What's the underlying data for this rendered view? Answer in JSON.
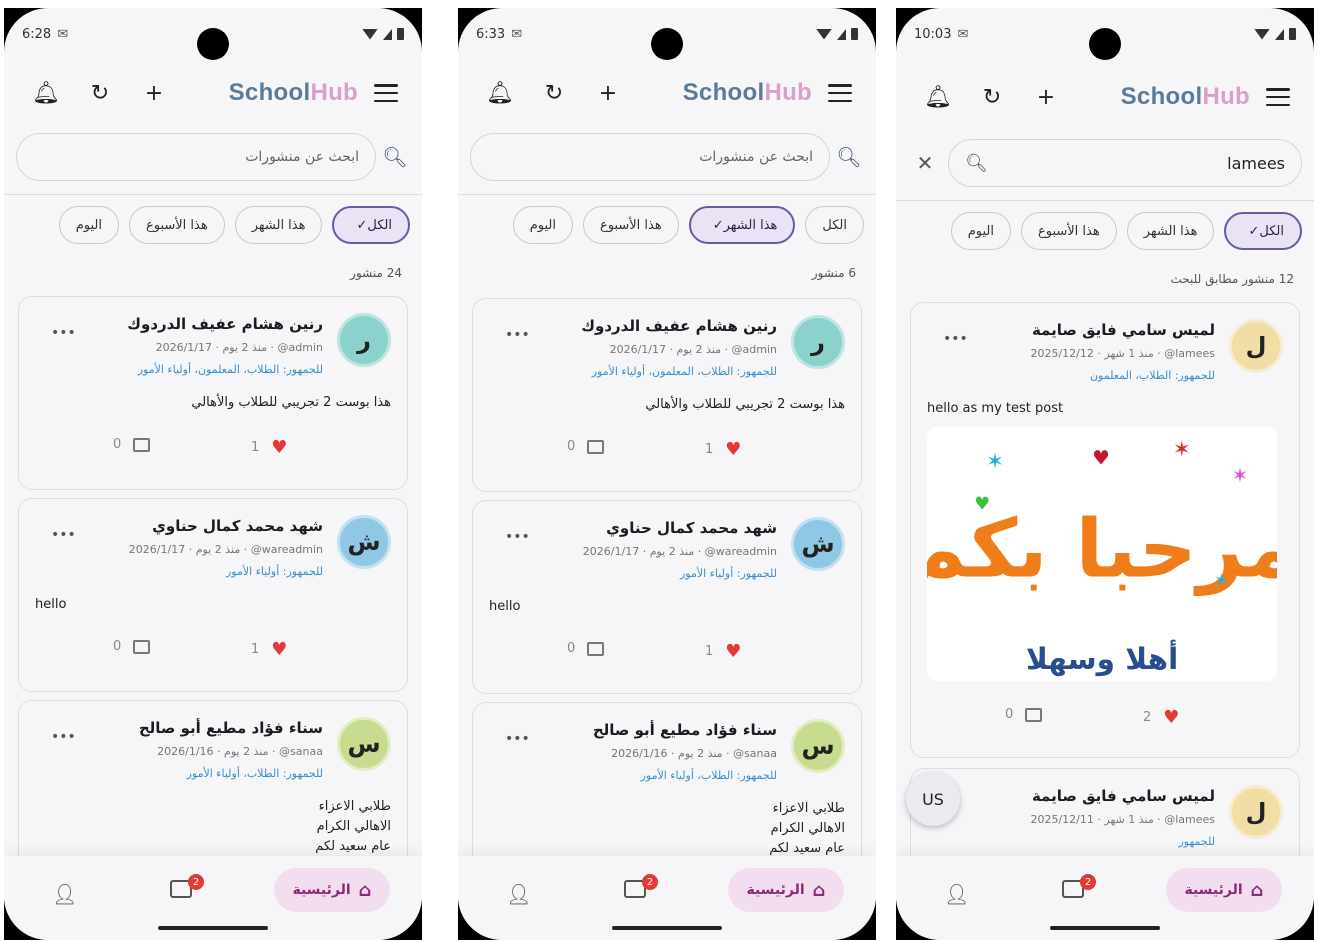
{
  "brand": {
    "part1": "School",
    "part2": "Hub"
  },
  "filters": [
    "الكل",
    "هذا الشهر",
    "هذا الأسبوع",
    "اليوم"
  ],
  "nav": {
    "home_label": "الرئيسية",
    "chat_badge": "2"
  },
  "screens": [
    {
      "time": "6:28",
      "search": {
        "placeholder": "ابحث عن منشورات",
        "value": ""
      },
      "count": "24 منشور",
      "posts": [
        {
          "initial": "ر",
          "name": "رنين هشام عفيف الدردوك",
          "meta": "admin@ · منذ 2 يوم · 2026/1/17",
          "audience": "للجمهور: الطلاب، المعلمون، أولياء الأمور",
          "body": "هذا بوست 2 تجريبي للطلاب والأهالي",
          "comments": "0",
          "likes": "1"
        },
        {
          "initial": "ش",
          "name": "شهد محمد كمال حناوي",
          "meta": "wareadmin@ · منذ 2 يوم · 2026/1/17",
          "audience": "للجمهور: أولياء الأمور",
          "body": "hello",
          "comments": "0",
          "likes": "1"
        },
        {
          "initial": "س",
          "name": "سناء فؤاد مطيع أبو صالح",
          "meta": "sanaa@ · منذ 2 يوم · 2026/1/16",
          "audience": "للجمهور: الطلاب، أولياء الأمور",
          "body_lines": [
            "طلابي الاعزاء",
            "الاهالي الكرام",
            "عام سعيد لكم"
          ]
        }
      ]
    },
    {
      "time": "6:33",
      "search": {
        "placeholder": "ابحث عن منشورات",
        "value": ""
      },
      "count": "6 منشور",
      "posts": [
        {
          "initial": "ر",
          "name": "رنين هشام عفيف الدردوك",
          "meta": "admin@ · منذ 2 يوم · 2026/1/17",
          "audience": "للجمهور: الطلاب، المعلمون، أولياء الأمور",
          "body": "هذا بوست 2 تجريبي للطلاب والأهالي",
          "comments": "0",
          "likes": "1"
        },
        {
          "initial": "ش",
          "name": "شهد محمد كمال حناوي",
          "meta": "wareadmin@ · منذ 2 يوم · 2026/1/17",
          "audience": "للجمهور: أولياء الأمور",
          "body": "hello",
          "comments": "0",
          "likes": "1"
        },
        {
          "initial": "س",
          "name": "سناء فؤاد مطيع أبو صالح",
          "meta": "sanaa@ · منذ 2 يوم · 2026/1/16",
          "audience": "للجمهور: الطلاب، أولياء الأمور",
          "body_lines": [
            "طلابي الاعزاء",
            "الاهالي الكرام",
            "عام سعيد لكم"
          ]
        }
      ]
    },
    {
      "time": "10:03",
      "search": {
        "placeholder": "",
        "value": "lamees"
      },
      "count": "12 منشور مطابق للبحث",
      "posts": [
        {
          "initial": "ل",
          "name": "لميس سامي فايق صايمة",
          "meta": "lamees@ · منذ 1 شهر · 2025/12/12",
          "audience": "للجمهور: الطلاب، المعلمون",
          "body": "hello as my test post",
          "image_text": "مرحبا بكم",
          "image_sub": "أهلا وسهلا",
          "comments": "0",
          "likes": "2"
        },
        {
          "initial": "ل",
          "name": "لميس سامي فايق صايمة",
          "meta": "lamees@ · منذ 1 شهر · 2025/12/11",
          "audience": "للجمهور"
        }
      ],
      "floating_avatar": "US"
    }
  ]
}
